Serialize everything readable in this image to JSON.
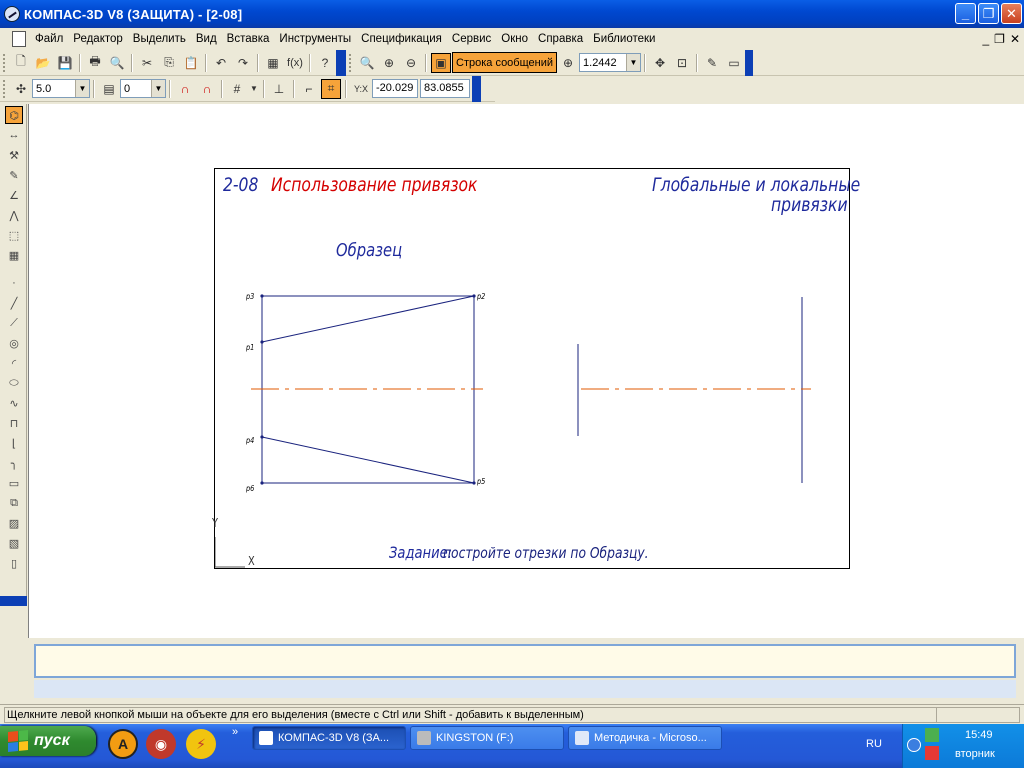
{
  "window": {
    "title": "КОМПАС-3D V8 (ЗАЩИТА) - [2-08]",
    "min": "_",
    "max": "❐",
    "close": "✕",
    "mdi_min": "_",
    "mdi_restore": "❐",
    "mdi_close": "✕"
  },
  "menu": [
    {
      "name": "file",
      "label": "Файл"
    },
    {
      "name": "edit",
      "label": "Редактор"
    },
    {
      "name": "select",
      "label": "Выделить"
    },
    {
      "name": "view",
      "label": "Вид"
    },
    {
      "name": "insert",
      "label": "Вставка"
    },
    {
      "name": "tools",
      "label": "Инструменты"
    },
    {
      "name": "spec",
      "label": "Спецификация"
    },
    {
      "name": "service",
      "label": "Сервис"
    },
    {
      "name": "window",
      "label": "Окно"
    },
    {
      "name": "help",
      "label": "Справка"
    },
    {
      "name": "libs",
      "label": "Библиотеки"
    }
  ],
  "toolbar": {
    "message_button": "Строка сообщений",
    "zoom_value": "1.2442",
    "fx_label": "f(x)",
    "step_value": "5.0",
    "layer_value": "0",
    "coord_x": "-20.029",
    "coord_y": "83.0855"
  },
  "drawing": {
    "title_number": "2-08",
    "title_name": "Использование привязок",
    "subtitle_line1": "Глобальные и локальные",
    "subtitle_line2": "привязки",
    "sample_label": "Образец",
    "task_label": "Задание:",
    "task_text": " постройте отрезки по Образцу.",
    "points": [
      "p3",
      "p2",
      "p1",
      "p4",
      "p6",
      "p5"
    ],
    "axis_y": "Y",
    "axis_x": "X",
    "colors": {
      "title_blue": "#1f2a9c",
      "title_red": "#d40000",
      "axis_orange": "#e05a00",
      "line": "#1a237e"
    }
  },
  "status": {
    "hint": "Щелкните левой кнопкой мыши на объекте для его выделения (вместе с Ctrl или Shift - добавить к выделенным)"
  },
  "taskbar": {
    "start": "пуск",
    "items": [
      {
        "label": "КОМПАС-3D V8 (ЗА..."
      },
      {
        "label": "KINGSTON (F:)"
      },
      {
        "label": "Методичка - Microso..."
      }
    ],
    "more": "»",
    "lang": "RU",
    "time": "15:49",
    "day": "вторник"
  }
}
